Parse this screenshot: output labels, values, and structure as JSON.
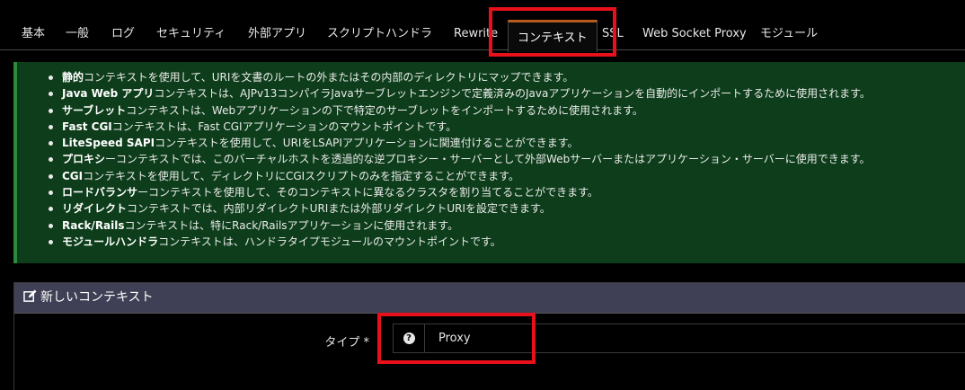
{
  "tabs": [
    {
      "label": "基本",
      "name": "tab-basic"
    },
    {
      "label": "一般",
      "name": "tab-general"
    },
    {
      "label": "ログ",
      "name": "tab-log"
    },
    {
      "label": "セキュリティ",
      "name": "tab-security"
    },
    {
      "label": "外部アプリ",
      "name": "tab-external-app"
    },
    {
      "label": "スクリプトハンドラ",
      "name": "tab-script-handler"
    },
    {
      "label": "Rewrite",
      "name": "tab-rewrite"
    },
    {
      "label": "コンテキスト",
      "name": "tab-context"
    },
    {
      "label": "SSL",
      "name": "tab-ssl"
    },
    {
      "label": "Web Socket Proxy",
      "name": "tab-websocket-proxy"
    },
    {
      "label": "モジュール",
      "name": "tab-modules"
    }
  ],
  "info": {
    "items": [
      {
        "bold": "静的",
        "text": "コンテキストを使用して、URIを文書のルートの外またはその内部のディレクトリにマップできます。"
      },
      {
        "bold": "Java Web アプリ",
        "text": "コンテキストは、AJPv13コンパイラJavaサーブレットエンジンで定義済みのJavaアプリケーションを自動的にインポートするために使用されます。"
      },
      {
        "bold": "サーブレット",
        "text": "コンテキストは、Webアプリケーションの下で特定のサーブレットをインポートするために使用されます。"
      },
      {
        "bold": "Fast CGI",
        "text": "コンテキストは、Fast CGIアプリケーションのマウントポイントです。"
      },
      {
        "bold": "LiteSpeed SAPI",
        "text": "コンテキストを使用して、URIをLSAPIアプリケーションに関連付けることができます。"
      },
      {
        "bold": "プロキシ",
        "text": "ーコンテキストでは、このバーチャルホストを透過的な逆プロキシー・サーバーとして外部Webサーバーまたはアプリケーション・サーバーに使用できます。"
      },
      {
        "bold": "CGI",
        "text": "コンテキストを使用して、ディレクトリにCGIスクリプトのみを指定することができます。"
      },
      {
        "bold": "ロードバランサ",
        "text": "ーコンテキストを使用して、そのコンテキストに異なるクラスタを割り当てることができます。"
      },
      {
        "bold": "リダイレクト",
        "text": "コンテキストでは、内部リダイレクトURIまたは外部リダイレクトURIを設定できます。"
      },
      {
        "bold": "Rack/Rails",
        "text": "コンテキストは、特にRack/Railsアプリケーションに使用されます。"
      },
      {
        "bold": "モジュールハンドラ",
        "text": "コンテキストは、ハンドラタイプモジュールのマウントポイントです。"
      }
    ]
  },
  "panel": {
    "title": "新しいコンテキスト",
    "type_label": "タイプ *",
    "type_value": "Proxy",
    "help_glyph": "?"
  },
  "icons": {
    "edit": "edit-icon",
    "help": "question-circle-icon"
  },
  "colors": {
    "highlight": "#e8101a",
    "active_tab_accent": "#b85c1e",
    "info_bg": "#0d3d1a",
    "panel_header": "#3f3f55"
  }
}
